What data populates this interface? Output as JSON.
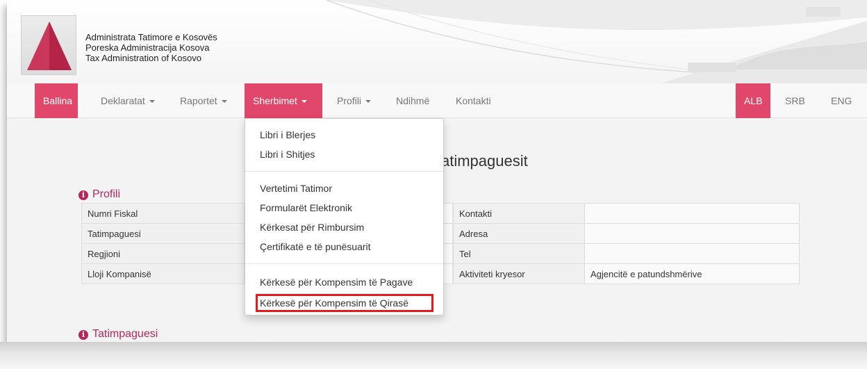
{
  "header": {
    "org_names": [
      "Administrata Tatimore e Kosovës",
      "Poreska Administracija Kosova",
      "Tax Administration of Kosovo"
    ]
  },
  "nav": {
    "items": [
      {
        "label": "Ballina",
        "dropdown": false,
        "active": true
      },
      {
        "label": "Deklaratat",
        "dropdown": true,
        "active": false
      },
      {
        "label": "Raportet",
        "dropdown": true,
        "active": false
      },
      {
        "label": "Sherbimet",
        "dropdown": true,
        "active": true
      },
      {
        "label": "Profili",
        "dropdown": true,
        "active": false
      },
      {
        "label": "Ndihmë",
        "dropdown": false,
        "active": false
      },
      {
        "label": "Kontakti",
        "dropdown": false,
        "active": false
      }
    ],
    "languages": [
      {
        "label": "ALB",
        "active": true
      },
      {
        "label": "SRB",
        "active": false
      },
      {
        "label": "ENG",
        "active": false
      }
    ]
  },
  "page": {
    "heading": "atimpaguesit"
  },
  "profile": {
    "title": "Profili",
    "left_rows": [
      {
        "label": "Numri Fiskal",
        "value": ""
      },
      {
        "label": "Tatimpaguesi",
        "value": ""
      },
      {
        "label": "Regjioni",
        "value": ""
      },
      {
        "label": "Lloji Kompanisë",
        "value": ""
      }
    ],
    "right_rows": [
      {
        "label": "Kontakti",
        "value": ""
      },
      {
        "label": "Adresa",
        "value": ""
      },
      {
        "label": "Tel",
        "value": ""
      },
      {
        "label": "Aktiviteti kryesor",
        "value": "Agjencitë e patundshmërive"
      }
    ]
  },
  "taxpayer_section": {
    "title": "Tatimpaguesi"
  },
  "sherbimet_menu": {
    "groups": [
      [
        "Libri i Blerjes",
        "Libri i Shitjes"
      ],
      [
        "Vertetimi Tatimor",
        "Formularët Elektronik",
        "Kërkesat për Rimbursim",
        "Çertifikatë e të punësuarit"
      ],
      [
        "Kërkesë për Kompensim të Pagave",
        "Kërkesë për Kompensim të Qirasë"
      ]
    ],
    "highlighted": "Kërkesë për Kompensim të Qirasë"
  },
  "colors": {
    "accent": "#e0476a",
    "section_title": "#b8275b",
    "highlight_border": "#e01c1c"
  }
}
